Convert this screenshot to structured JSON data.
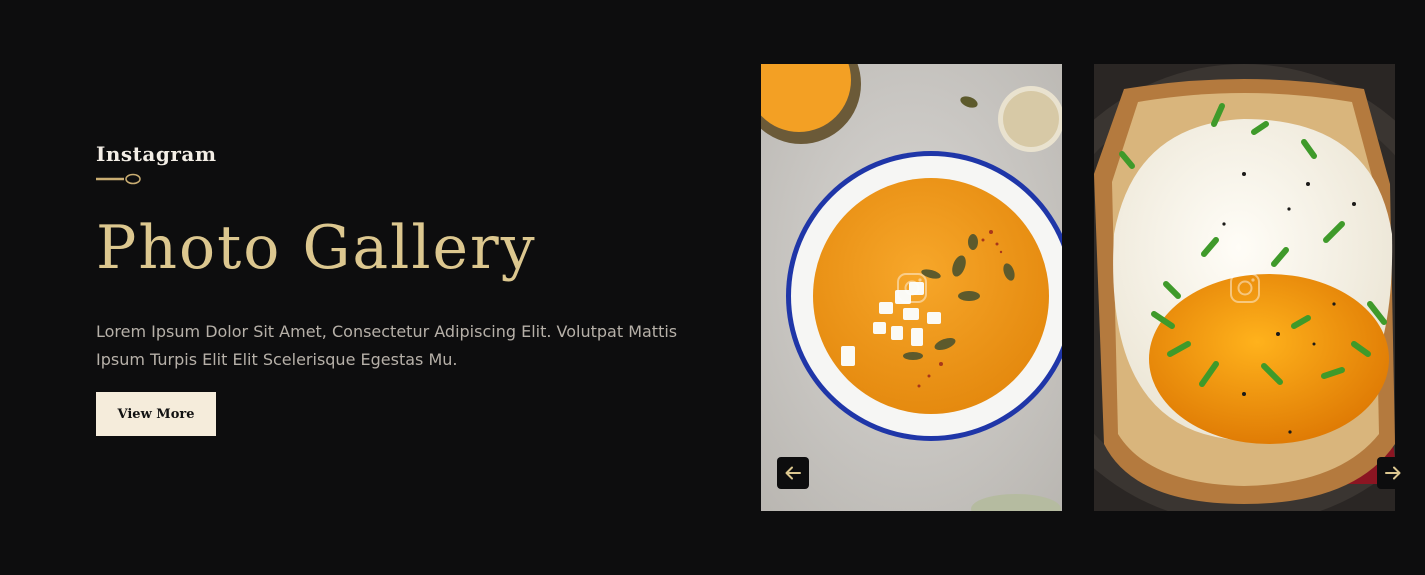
{
  "section": {
    "subtitle": "Instagram",
    "title": "Photo Gallery",
    "description": "Lorem Ipsum Dolor Sit Amet, Consectetur Adipiscing Elit. Volutpat Mattis Ipsum Turpis Elit Elit Scelerisque Egestas Mu.",
    "button_label": "View More"
  },
  "gallery": {
    "items": [
      {
        "photo": "pumpkin-soup-bowl",
        "overlay_icon": "instagram-icon"
      },
      {
        "photo": "fried-egg-toast",
        "overlay_icon": "instagram-icon"
      }
    ],
    "prev_icon": "arrow-left-icon",
    "next_icon": "arrow-right-icon"
  },
  "colors": {
    "background": "#0d0d0e",
    "accent_gold": "#dcc78f",
    "button_bg": "#f5ecdb",
    "text_muted": "#b6b0a8"
  }
}
